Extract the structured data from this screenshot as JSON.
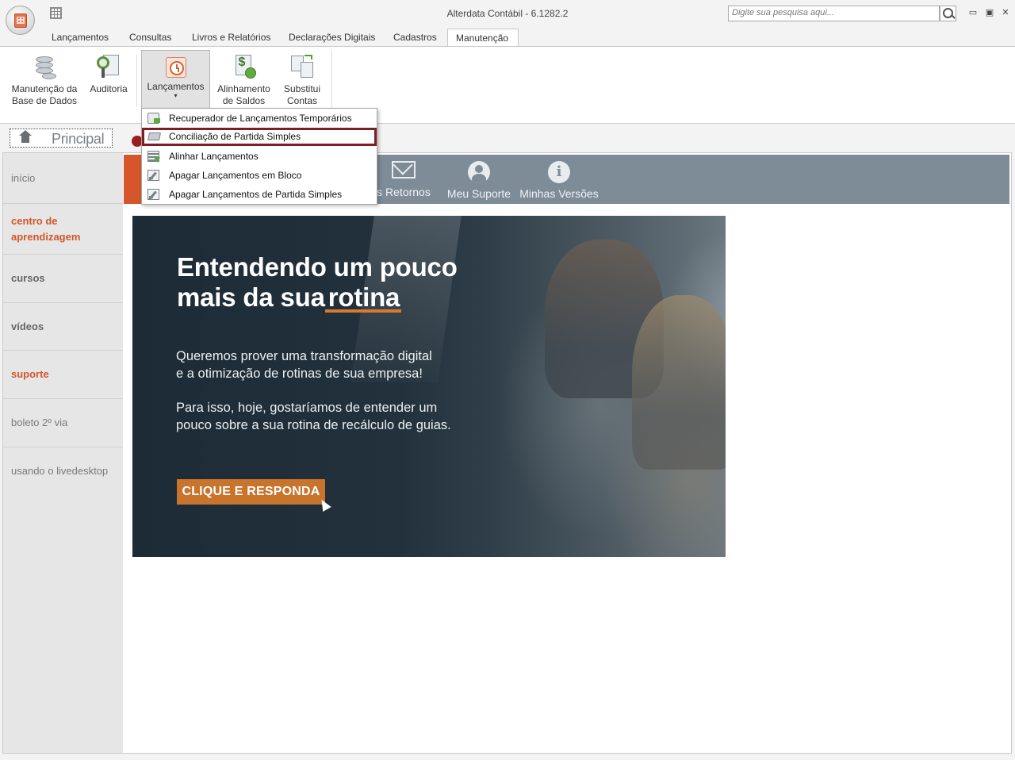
{
  "window": {
    "title": "Alterdata Contábil - 6.1282.2",
    "search_placeholder": "Digite sua pesquisa aqui...",
    "controls": {
      "minimize": "▭",
      "restore": "▣",
      "close": "✕"
    }
  },
  "ribbon_tabs": [
    "Lançamentos",
    "Consultas",
    "Livros e Relatórios",
    "Declarações Digitais",
    "Cadastros",
    "Manutenção"
  ],
  "ribbon_active_tab": "Manutenção",
  "ribbon_buttons": {
    "manutencao_line1": "Manutenção da",
    "manutencao_line2": "Base de Dados",
    "auditoria": "Auditoria",
    "lancamentos": "Lançamentos",
    "lancamentos_arrow": "▾",
    "alinhamento_line1": "Alinhamento",
    "alinhamento_line2": "de Saldos",
    "substitui_line1": "Substitui",
    "substitui_line2": "Contas"
  },
  "dropdown_menu": {
    "items": [
      "Recuperador de Lançamentos Temporários",
      "Conciliação de Partida Simples",
      "Alinhar Lançamentos",
      "Apagar Lançamentos em Bloco",
      "Apagar Lançamentos de Partida Simples"
    ],
    "highlighted_index": 1
  },
  "doc_tab": {
    "label": "Principal"
  },
  "sidebar": {
    "items": [
      {
        "label": "início"
      },
      {
        "label": "centro de aprendizagem"
      },
      {
        "label": "cursos"
      },
      {
        "label": "vídeos"
      },
      {
        "label": "suporte"
      },
      {
        "label": "boleto 2º via"
      },
      {
        "label": "usando o livedesktop"
      }
    ]
  },
  "topbar": {
    "items": [
      {
        "label": "s Retornos",
        "icon": "envelope-icon"
      },
      {
        "label": "Meu Suporte",
        "icon": "user-icon"
      },
      {
        "label": "Minhas Versões",
        "icon": "info-icon"
      }
    ]
  },
  "banner": {
    "title_line1": "Entendendo um pouco",
    "title_line2_prefix": "mais da sua",
    "title_line2_emph": "rotina",
    "para1_line1": "Queremos prover uma transformação digital",
    "para1_line2": "e a otimização de rotinas de sua empresa!",
    "para2_line1": "Para isso, hoje, gostaríamos de entender um",
    "para2_line2": "pouco sobre a sua rotina de recálculo de guias.",
    "cta": "CLIQUE E RESPONDA"
  },
  "colors": {
    "accent_orange": "#d4562a",
    "menu_highlight_border": "#7d1d24",
    "topbar_bg": "#7d8c97",
    "cta_bg": "#c8742c"
  }
}
